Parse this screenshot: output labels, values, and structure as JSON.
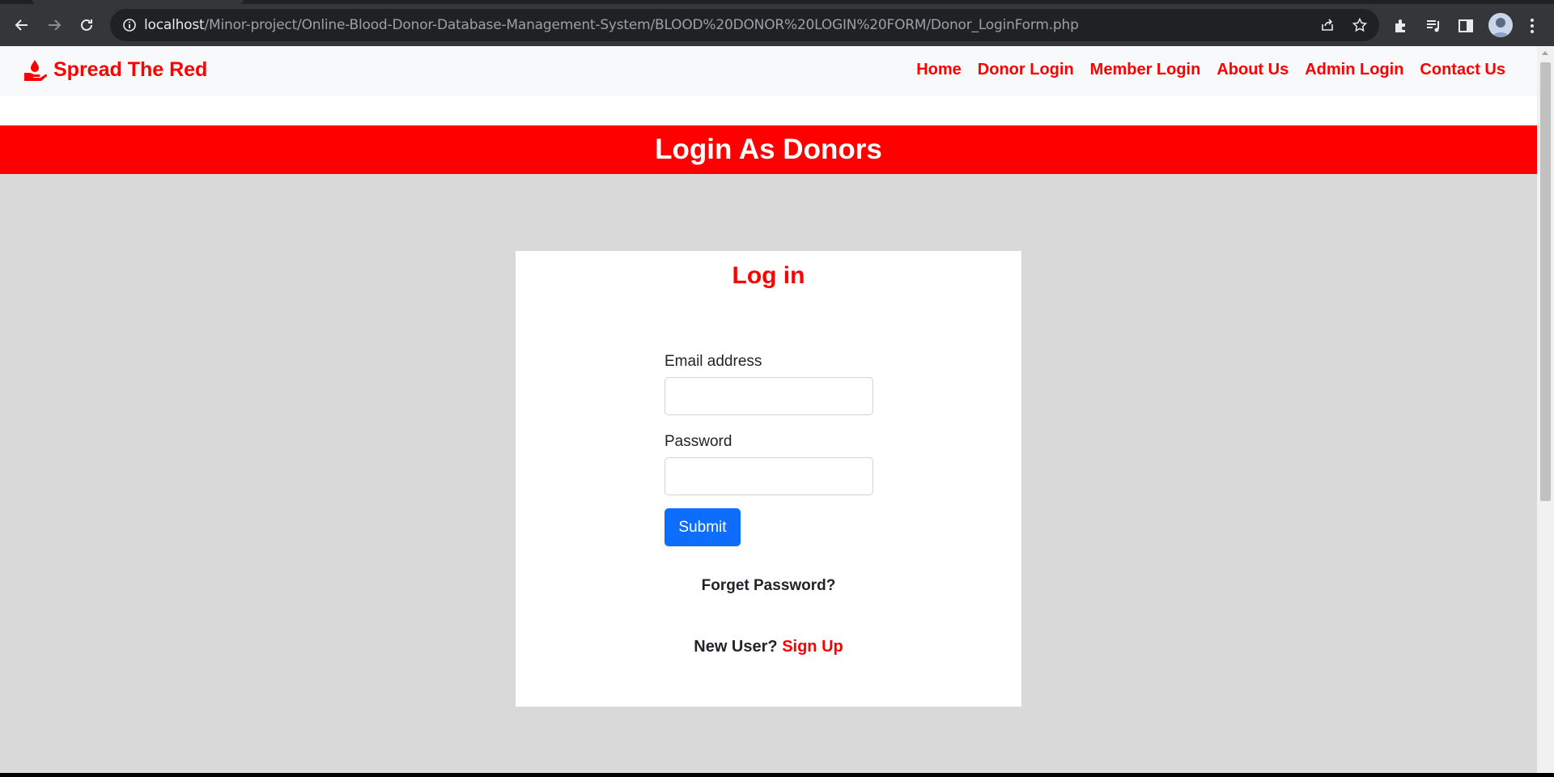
{
  "browser": {
    "url_host": "localhost",
    "url_path": "/Minor-project/Online-Blood-Donor-Database-Management-System/BLOOD%20DONOR%20LOGIN%20FORM/Donor_LoginForm.php"
  },
  "navbar": {
    "brand": "Spread The Red",
    "links": [
      "Home",
      "Donor Login",
      "Member Login",
      "About Us",
      "Admin Login",
      "Contact Us"
    ]
  },
  "banner": {
    "title": "Login As Donors"
  },
  "login": {
    "heading": "Log in",
    "email_label": "Email address",
    "email_value": "",
    "password_label": "Password",
    "password_value": "",
    "submit_label": "Submit",
    "forget_label": "Forget Password?",
    "new_user_text": "New User?",
    "signup_label": "Sign Up"
  },
  "colors": {
    "brand_red": "#ff0000",
    "primary_blue": "#0d6efd",
    "page_bg": "#d9d9d9"
  }
}
